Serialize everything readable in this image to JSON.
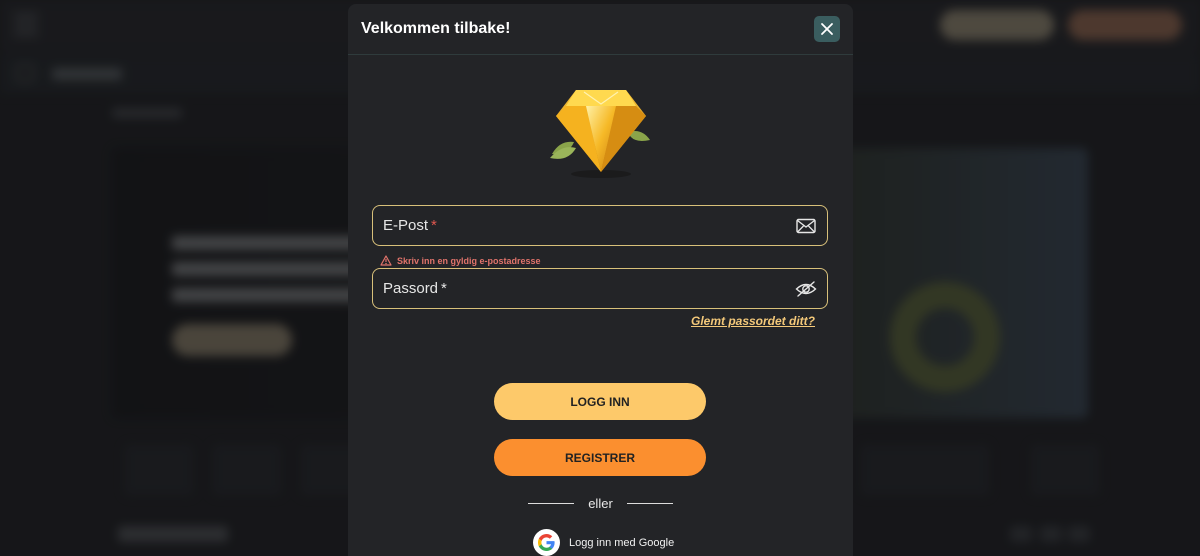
{
  "modal": {
    "title": "Velkommen tilbake!",
    "close_icon": "close-icon",
    "logo_icon": "diamond-icon"
  },
  "form": {
    "email": {
      "label": "E-Post",
      "required_mark": "*",
      "value": "",
      "icon": "envelope-icon",
      "error": "Skriv inn en gyldig e-postadresse",
      "error_icon": "warning-icon"
    },
    "password": {
      "label": "Passord",
      "required_mark": "*",
      "value": "",
      "icon": "eye-icon"
    },
    "forgot_password": "Glemt passordet ditt?"
  },
  "actions": {
    "login_label": "LOGG INN",
    "register_label": "REGISTRER",
    "divider_text": "eller",
    "google_label": "Logg inn med Google",
    "google_icon": "google-icon"
  },
  "colors": {
    "accent_login": "#fdc96a",
    "accent_register": "#fb8f2f",
    "field_border": "#d8c07a",
    "error": "#e0736b",
    "close_bg": "#3a5d5f"
  }
}
